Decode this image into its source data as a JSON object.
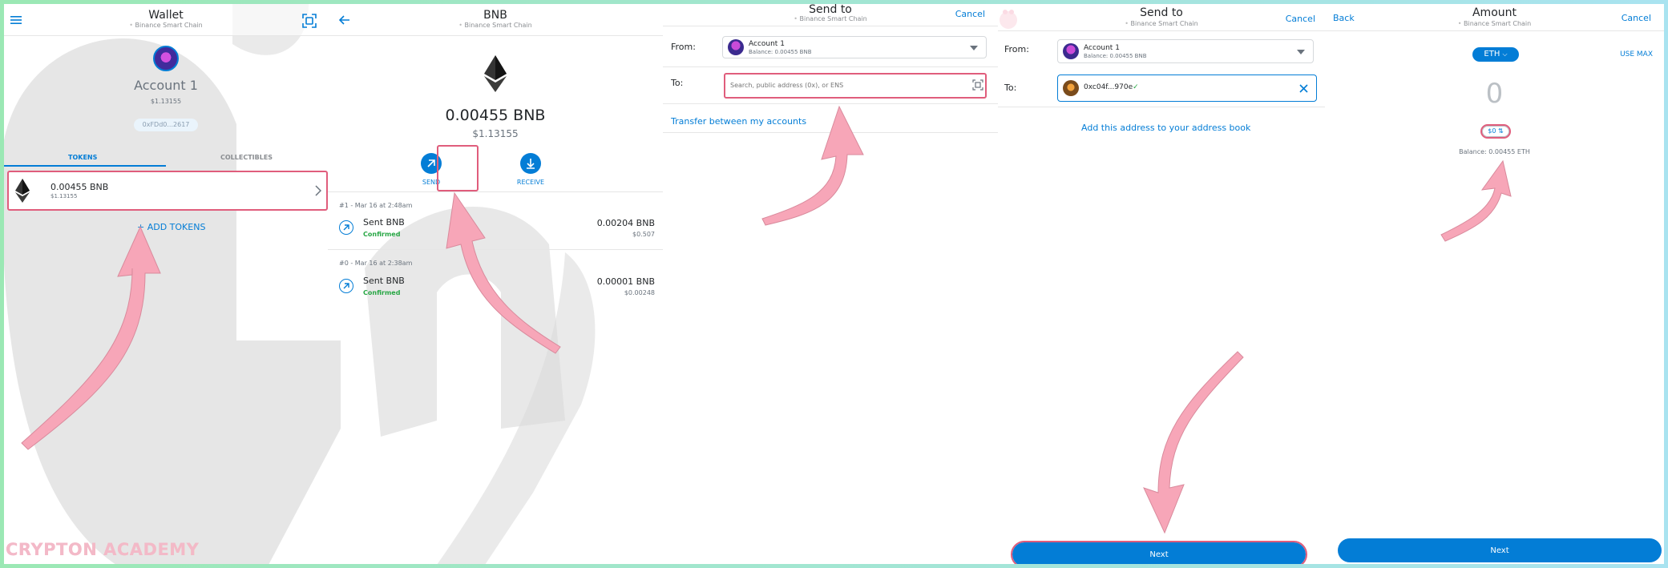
{
  "wallet": {
    "title": "Wallet",
    "network": "Binance Smart Chain",
    "account_name": "Account 1",
    "account_fiat": "$1.13155",
    "address_short": "0xFDd0...2617",
    "tabs": [
      "TOKENS",
      "COLLECTIBLES"
    ],
    "token": {
      "amount": "0.00455 BNB",
      "fiat": "$1.13155"
    },
    "add_tokens": "ADD TOKENS"
  },
  "asset": {
    "title": "BNB",
    "network": "Binance Smart Chain",
    "balance": "0.00455 BNB",
    "fiat": "$1.13155",
    "send_label": "SEND",
    "receive_label": "RECEIVE",
    "transactions": [
      {
        "date": "#1 - Mar 16 at 2:48am",
        "title": "Sent BNB",
        "status": "Confirmed",
        "amount": "0.00204 BNB",
        "fiat": "$0.507"
      },
      {
        "date": "#0 - Mar 16 at 2:38am",
        "title": "Sent BNB",
        "status": "Confirmed",
        "amount": "0.00001 BNB",
        "fiat": "$0.00248"
      }
    ]
  },
  "sendto": {
    "title": "Send to",
    "network": "Binance Smart Chain",
    "cancel": "Cancel",
    "from_label": "From:",
    "to_label": "To:",
    "account_name": "Account 1",
    "account_balance": "Balance: 0.00455 BNB",
    "to_placeholder": "Search, public address (0x), or ENS",
    "transfer_link": "Transfer between my accounts"
  },
  "sendto2": {
    "title": "Send to",
    "network": "Binance Smart Chain",
    "cancel": "Cancel",
    "from_label": "From:",
    "to_label": "To:",
    "account_name": "Account 1",
    "account_balance": "Balance: 0.00455 BNB",
    "to_address": "0xc04f...970e",
    "address_book_link": "Add this address to your address book",
    "next": "Next"
  },
  "amount": {
    "back": "Back",
    "title": "Amount",
    "network": "Binance Smart Chain",
    "cancel": "Cancel",
    "asset_selector": "ETH",
    "use_max": "USE MAX",
    "value": "0",
    "fiat_toggle": "$0",
    "balance": "Balance: 0.00455 ETH",
    "next": "Next"
  },
  "watermark_brand": "CRYPTON ACADEMY",
  "colors": {
    "accent": "#037dd6",
    "highlight": "#e05d7c",
    "confirmed": "#28a745",
    "arrow": "#f7a6b8"
  },
  "icons": [
    "menu-icon",
    "scan-icon",
    "back-arrow-icon",
    "eth-logo-icon",
    "send-icon",
    "receive-icon",
    "chevron-right-icon",
    "chevron-down-icon",
    "qr-scan-icon",
    "close-icon",
    "sent-tx-icon",
    "swap-icon"
  ]
}
